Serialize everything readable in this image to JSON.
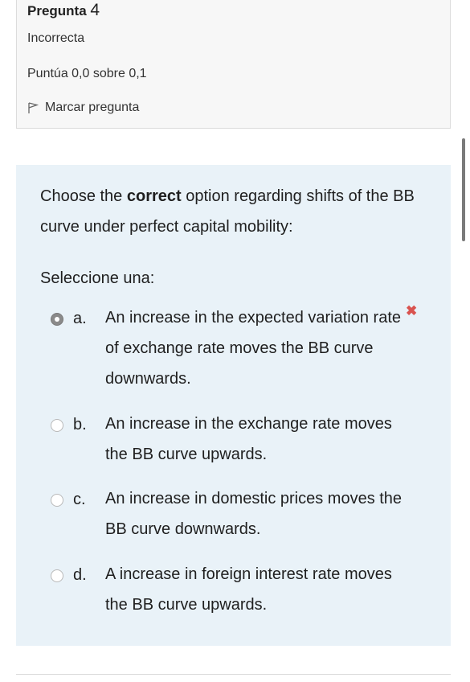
{
  "question": {
    "title_label": "Pregunta",
    "number": "4",
    "state": "Incorrecta",
    "grade": "Puntúa 0,0 sobre 0,1",
    "flag_label": "Marcar pregunta"
  },
  "content": {
    "text_before": "Choose the ",
    "text_bold": "correct",
    "text_after": " option regarding shifts of the BB curve under perfect capital mobility:",
    "prompt": "Seleccione una:",
    "options": [
      {
        "letter": "a.",
        "text": "An increase in the expected variation rate of exchange rate moves the BB curve downwards.",
        "selected": true,
        "incorrect_mark": "✖"
      },
      {
        "letter": "b.",
        "text": "An increase in the exchange rate moves the BB curve upwards.",
        "selected": false
      },
      {
        "letter": "c.",
        "text": "An increase in domestic prices moves the BB curve downwards.",
        "selected": false
      },
      {
        "letter": "d.",
        "text": "A increase in foreign interest rate moves the BB curve upwards.",
        "selected": false
      }
    ]
  },
  "colors": {
    "content_bg": "#e9f2f8",
    "info_bg": "#f7f7f7",
    "incorrect": "#d9534f"
  }
}
